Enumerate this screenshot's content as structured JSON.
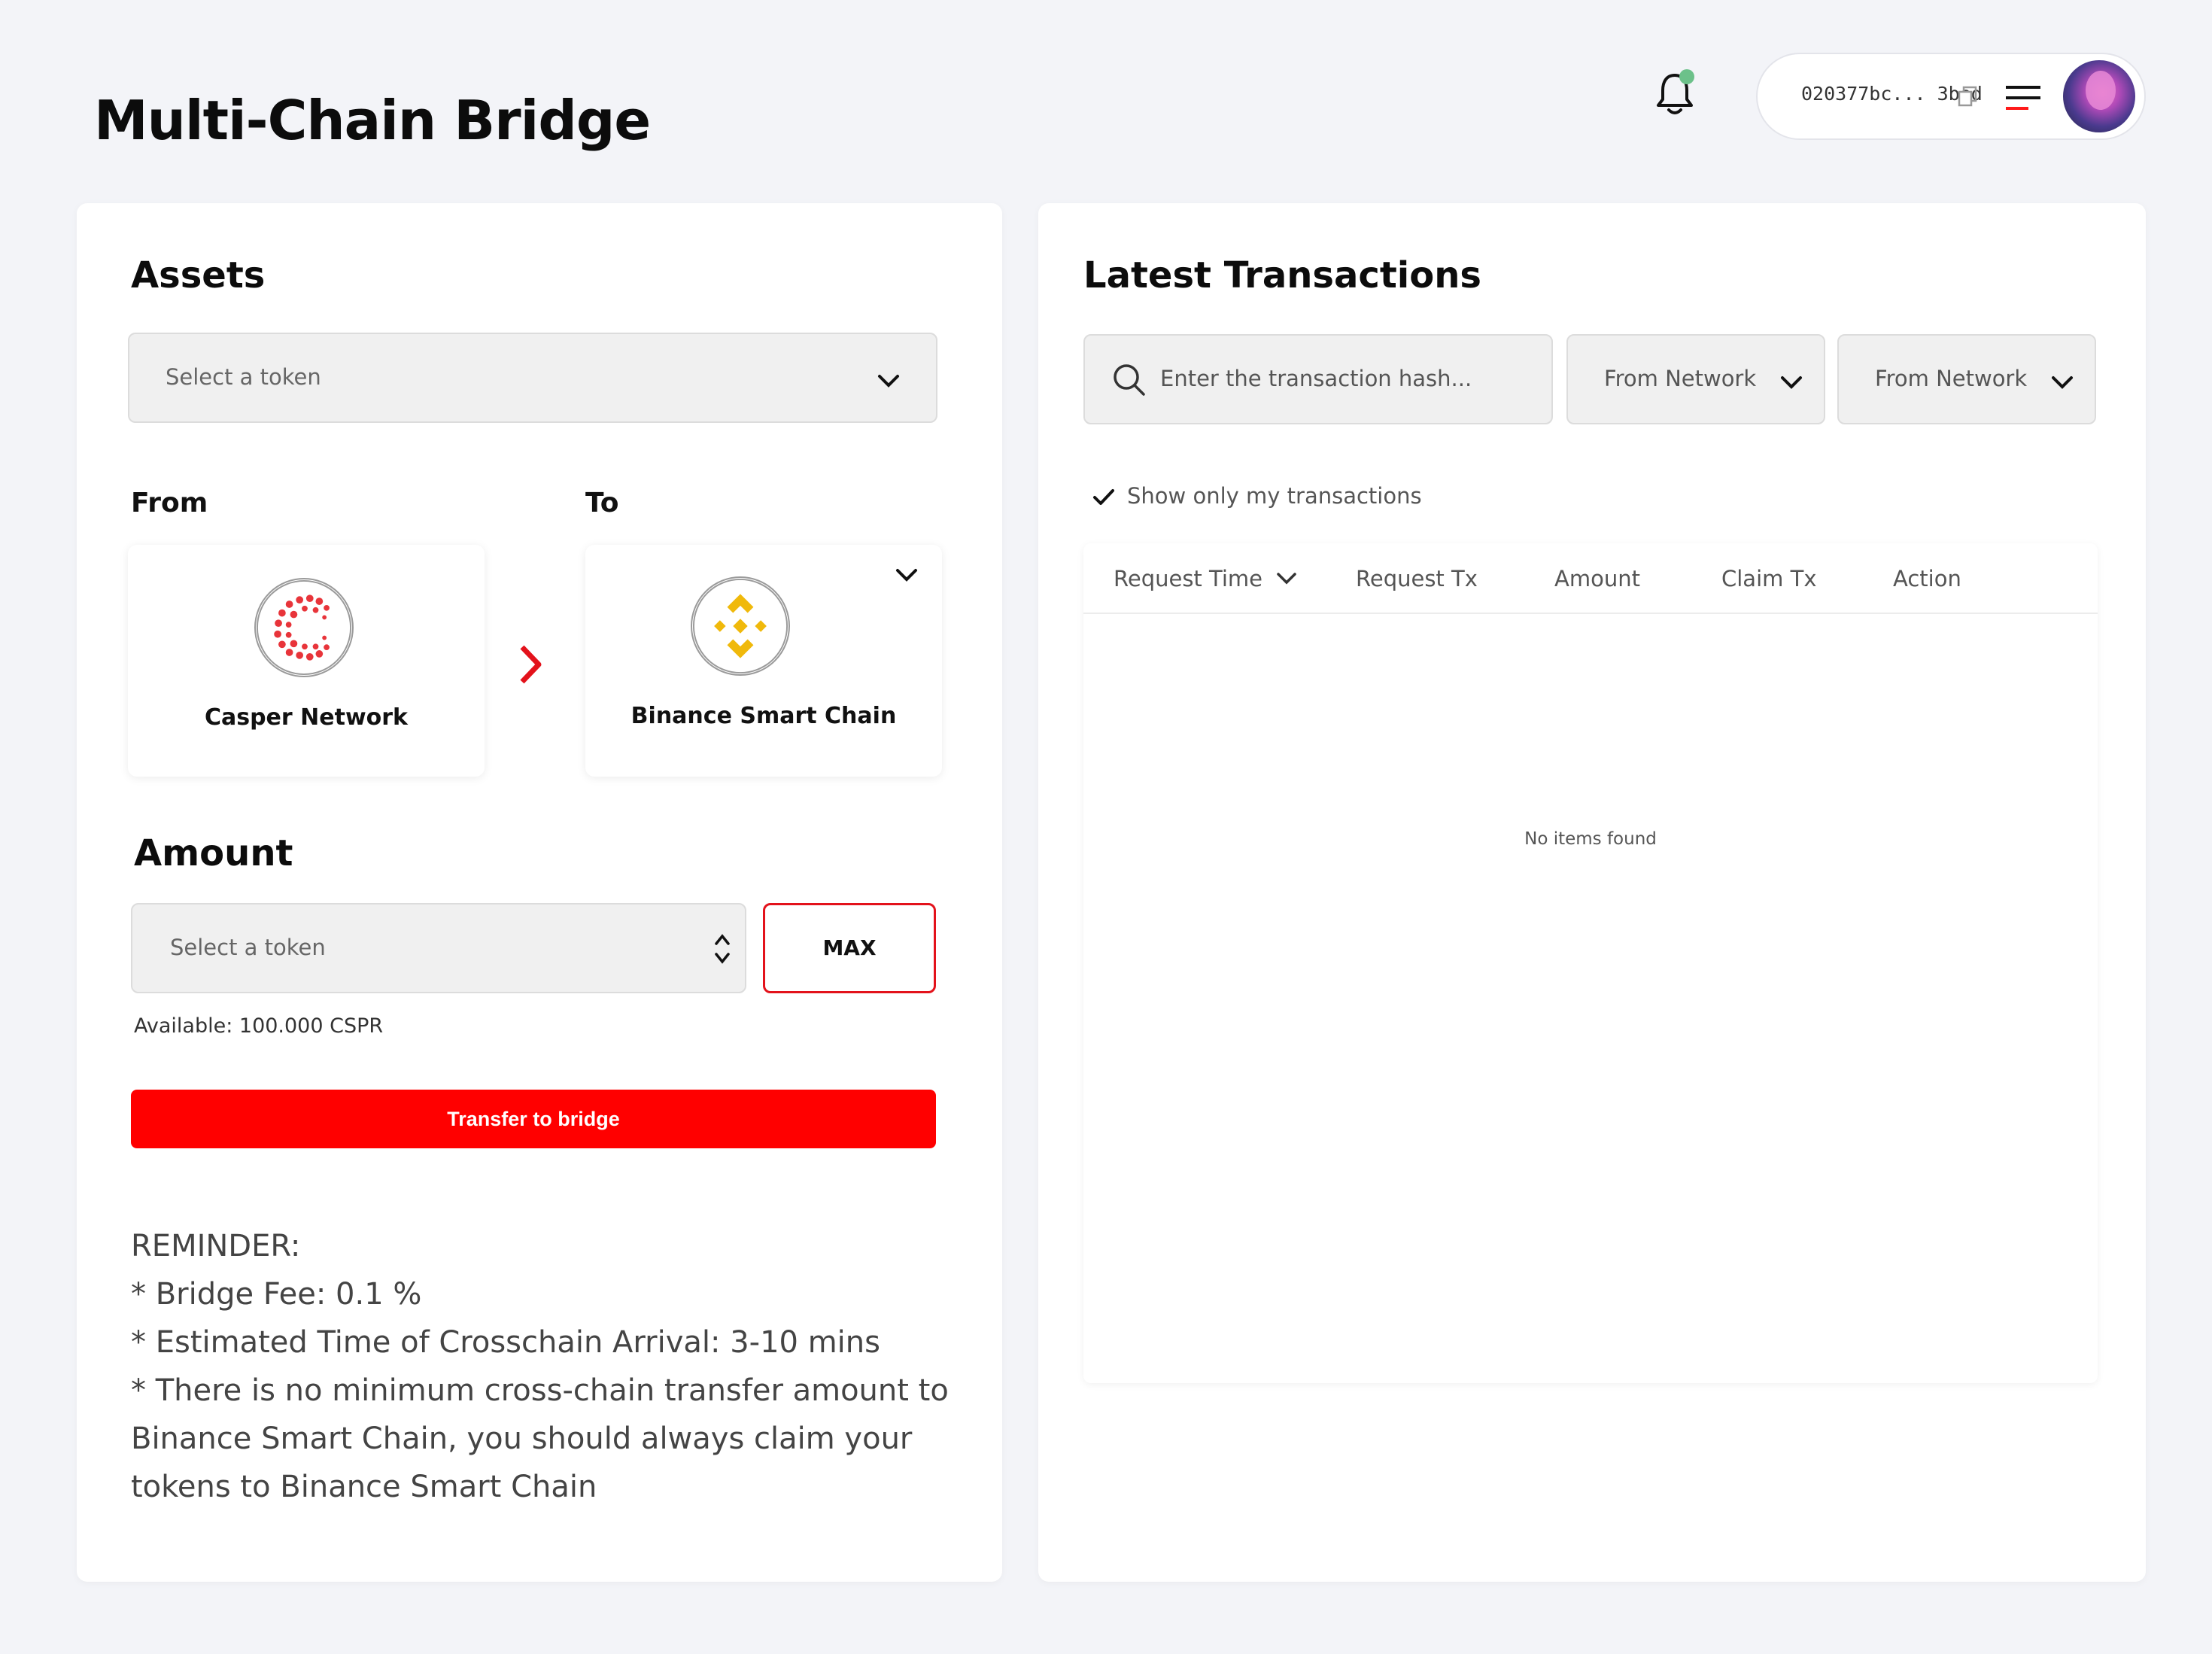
{
  "header": {
    "title": "Multi-Chain Bridge",
    "wallet_address": "020377bc... 3bed",
    "icons": [
      "bell-icon",
      "copy-icon",
      "menu-icon"
    ]
  },
  "assets": {
    "title": "Assets",
    "token_select_placeholder": "Select a  token"
  },
  "route": {
    "from_label": "From",
    "to_label": "To",
    "from_network": "Casper Network",
    "to_network": "Binance Smart Chain"
  },
  "amount": {
    "title": "Amount",
    "placeholder": "Select a  token",
    "max_label": "MAX",
    "available": "Available: 100.000 CSPR"
  },
  "transfer_button": "Transfer to bridge",
  "reminder": {
    "heading": "REMINDER:",
    "lines": [
      "* Bridge Fee: 0.1 %",
      "* Estimated Time of Crosschain Arrival: 3-10 mins",
      "* There is no minimum cross-chain transfer amount to Binance Smart Chain, you should always claim your tokens to Binance Smart Chain"
    ]
  },
  "transactions": {
    "title": "Latest Transactions",
    "search_placeholder": "Enter the transaction hash...",
    "filter_1": "From Network",
    "filter_2": "From Network",
    "show_only_mine": "Show only my transactions",
    "columns": [
      "Request Time",
      "Request Tx",
      "Amount",
      "Claim Tx",
      "Action"
    ],
    "empty_text": "No items found"
  },
  "colors": {
    "accent_red": "#ff0000",
    "casper_red": "#e8343a",
    "binance_yellow": "#f0b90b",
    "notification_dot": "#6cc18a"
  }
}
